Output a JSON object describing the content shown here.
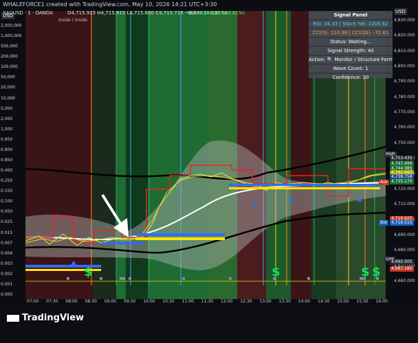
{
  "header": {
    "created_line": "WHALEFORCE1 created with TradingView.com, May 10, 2026 14:21 UTC+3:30",
    "symbol_line": "XAUUSD · 1 · OANDA",
    "ohlc": "O4,715.915 H4,715.915 L4,715.650 C4,715.715 −0.380 (−0.01%)",
    "vol": "Vol",
    "vol_value": "−28.535 (+0.61%)",
    "sub_line": "Inside ( Inside"
  },
  "left_axis": {
    "currency": "USD",
    "ticks": [
      "2,000,000",
      "1,000,000",
      "500,000",
      "200,000",
      "100,000",
      "50,000",
      "20,000",
      "10,000",
      "5,000",
      "2,000",
      "1,000",
      "0.950",
      "0.900",
      "0.850",
      "0.450",
      "0.250",
      "0.150",
      "0.100",
      "0.050",
      "0.025",
      "0.015",
      "0.007",
      "0.004",
      "0.003",
      "0.002",
      "0.001",
      "0.000"
    ]
  },
  "right_axis": {
    "currency": "USD",
    "ticks": [
      "4,830.000",
      "4,820.000",
      "4,810.000",
      "4,800.000",
      "4,790.000",
      "4,780.000",
      "4,770.000",
      "4,760.000",
      "4,750.000",
      "4,740.000",
      "4,730.000",
      "4,720.000",
      "4,710.000",
      "4,700.000",
      "4,690.000",
      "4,680.000",
      "4,670.000",
      "4,660.000"
    ],
    "labels": [
      {
        "text": "High",
        "color": "#2a2e39"
      },
      {
        "text": "4,753.435",
        "color": "#2a2e39"
      },
      {
        "text": "4,747.499",
        "color": "#1a6b2e"
      },
      {
        "text": "4,744.985",
        "color": "#1a6b2e"
      },
      {
        "text": "4,741.460",
        "color": "#b8a000"
      },
      {
        "text": "4,738.758",
        "color": "#1a4f8a"
      },
      {
        "text": "4,735.170",
        "color": "#1a6b2e"
      },
      {
        "text": "Ask",
        "color": "#c0392b"
      },
      {
        "text": "4,716.925",
        "color": "#c0392b"
      },
      {
        "text": "Bid",
        "color": "#1565c0"
      },
      {
        "text": "4,716.510",
        "color": "#1565c0"
      },
      {
        "text": "Low",
        "color": "#2a2e39"
      },
      {
        "text": "4,692.505",
        "color": "#2a2e39"
      },
      {
        "text": "4,687.180",
        "color": "#c0392b"
      }
    ]
  },
  "time_axis": [
    "07:00",
    "07:30",
    "08:00",
    "08:30",
    "09:00",
    "09:30",
    "10:00",
    "10:30",
    "11:00",
    "11:30",
    "12:00",
    "12:30",
    "13:00",
    "13:30",
    "14:00",
    "14:30",
    "15:00",
    "15:30",
    "16:00"
  ],
  "signal_panel": {
    "title": "Signal Panel",
    "rsi_stoch": "RSI: 34.33 | Stoch %K: 2205.62",
    "cci": "CCI(5): 110.38 | CCI(20): -72.61",
    "status": "Status: Waiting...",
    "strength": "Signal Strength: 40",
    "action": "Action: 🔍 Monitor / Structure Forming",
    "wave_count": "Wave Count: 1",
    "confidence": "Confidence: 30"
  },
  "markers": {
    "dollar_symbol": "$"
  },
  "footer": {
    "brand": "TradingView"
  },
  "colors": {
    "background": "#0b0d12",
    "bull_zone": "#1f6b33",
    "bear_zone": "#6b2323",
    "accent_yellow": "#ffe600",
    "accent_blue": "#2f6bff",
    "ma_black": "#000000",
    "ma_white": "#ffffff",
    "band_grey": "#8d8d8d",
    "signal_green": "#17e05a"
  }
}
